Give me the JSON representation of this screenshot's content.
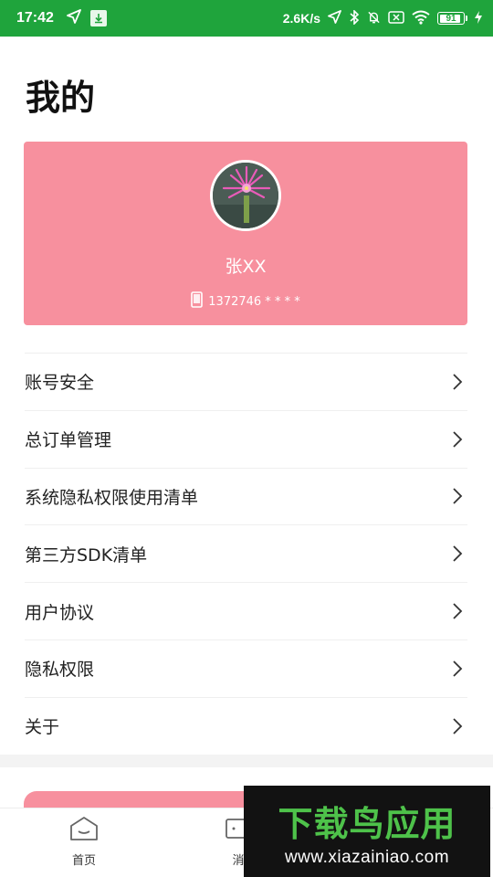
{
  "status_bar": {
    "time": "17:42",
    "network_speed": "2.6K/s",
    "battery_level": "91",
    "battery_fraction": 0.91,
    "icons": [
      "location-arrow-icon",
      "download-icon",
      "bluetooth-icon",
      "bell-muted-icon",
      "no-sim-icon",
      "wifi-icon",
      "battery-icon",
      "charging-bolt-icon"
    ]
  },
  "page": {
    "title": "我的"
  },
  "profile": {
    "name": "张XX",
    "phone": "1372746 * * * *",
    "card_color": "#f7909e"
  },
  "menu": {
    "items": [
      {
        "label": "账号安全"
      },
      {
        "label": "总订单管理"
      },
      {
        "label": "系统隐私权限使用清单"
      },
      {
        "label": "第三方SDK清单"
      },
      {
        "label": "用户协议"
      },
      {
        "label": "隐私权限"
      },
      {
        "label": "关于"
      }
    ]
  },
  "tab_bar": {
    "tabs": [
      {
        "label": "首页",
        "icon": "home-icon"
      },
      {
        "label": "消",
        "icon": "message-icon"
      }
    ]
  },
  "watermark": {
    "title": "下载鸟应用",
    "url": "www.xiazainiao.com"
  },
  "colors": {
    "status_bar": "#1fa43c",
    "accent_pink": "#f7909e",
    "watermark_green": "#4ec24a"
  }
}
